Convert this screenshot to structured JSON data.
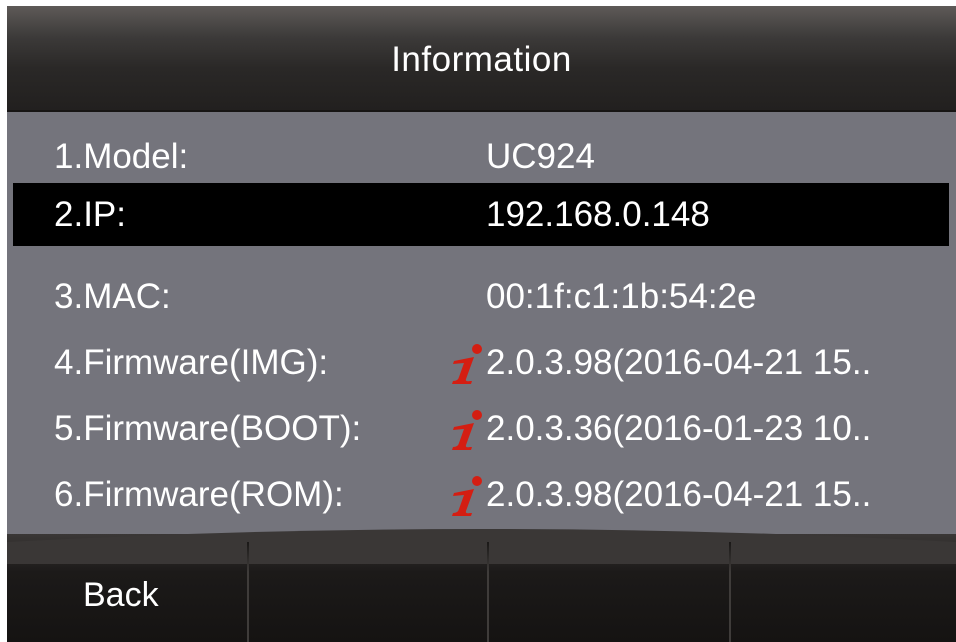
{
  "header": {
    "title": "Information"
  },
  "rows": [
    {
      "label": "1.Model:",
      "value": "UC924",
      "selected": false,
      "icon": null
    },
    {
      "label": "2.IP:",
      "value": "192.168.0.148",
      "selected": true,
      "icon": null
    },
    {
      "label": "3.MAC:",
      "value": "00:1f:c1:1b:54:2e",
      "selected": false,
      "icon": null
    },
    {
      "label": "4.Firmware(IMG):",
      "value": "2.0.3.98(2016-04-21 15..",
      "selected": false,
      "icon": "info-icon"
    },
    {
      "label": "5.Firmware(BOOT):",
      "value": "2.0.3.36(2016-01-23 10..",
      "selected": false,
      "icon": "info-icon"
    },
    {
      "label": "6.Firmware(ROM):",
      "value": "2.0.3.98(2016-04-21 15..",
      "selected": false,
      "icon": "info-icon"
    }
  ],
  "softkeys": [
    {
      "label": "Back"
    },
    {
      "label": ""
    },
    {
      "label": ""
    },
    {
      "label": ""
    }
  ],
  "colors": {
    "background": "#74747c",
    "selected_row": "#000000",
    "text": "#ffffff",
    "info_icon": "#d41e12"
  }
}
